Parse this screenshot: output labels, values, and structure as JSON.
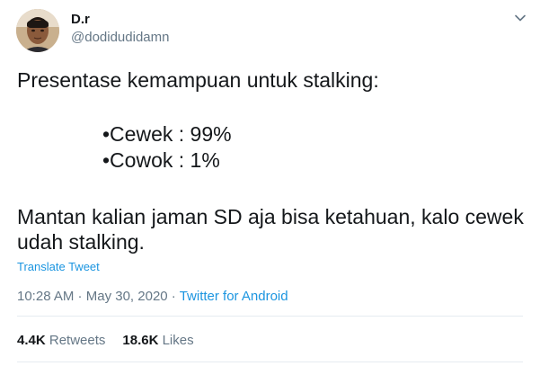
{
  "author": {
    "display_name": "D.r",
    "handle": "@dodidudidamn"
  },
  "icons": {
    "menu": "chevron-down-icon",
    "avatar": "profile-photo"
  },
  "tweet": {
    "line1": "Presentase kemampuan untuk stalking:",
    "line2": "•Cewek : 99%",
    "line3": "•Cowok :  1%",
    "line4": "Mantan kalian jaman SD aja bisa ketahuan, kalo cewek",
    "line5": "udah stalking."
  },
  "translate_label": "Translate Tweet",
  "meta": {
    "time": "10:28 AM",
    "separator": " · ",
    "date": "May 30, 2020",
    "source": "Twitter for Android"
  },
  "stats": {
    "retweets_count": "4.4K",
    "retweets_label": "Retweets",
    "likes_count": "18.6K",
    "likes_label": "Likes"
  },
  "colors": {
    "link": "#1b95e0",
    "secondary_text": "#657786",
    "primary_text": "#14171a",
    "divider": "#e6ecf0"
  }
}
